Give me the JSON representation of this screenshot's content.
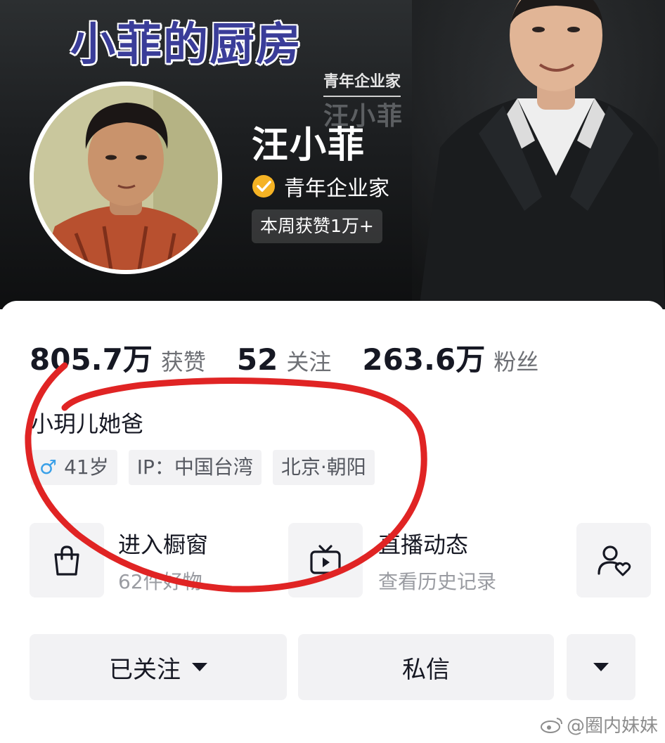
{
  "banner": {
    "title": "小菲的厨房",
    "tagline": "青年企业家",
    "name_ghost": "汪小菲"
  },
  "profile": {
    "name": "汪小菲",
    "verified_text": "青年企业家",
    "weekly_badge": "本周获赞1万+",
    "bio": "小玥儿她爸"
  },
  "stats": [
    {
      "value": "805.7万",
      "label": "获赞"
    },
    {
      "value": "52",
      "label": "关注"
    },
    {
      "value": "263.6万",
      "label": "粉丝"
    }
  ],
  "tags": {
    "gender_icon": "♂",
    "age": "41岁",
    "ip": "IP：中国台湾",
    "location": "北京·朝阳"
  },
  "tiles": {
    "shop_title": "进入橱窗",
    "shop_sub": "62件好物",
    "live_title": "直播动态",
    "live_sub": "查看历史记录"
  },
  "actions": {
    "follow": "已关注",
    "message": "私信"
  },
  "watermark": "@圈内妹妹",
  "colors": {
    "annotation": "#e02424",
    "verified": "#f5b324",
    "gender": "#3aa0e8",
    "title_purple": "#3a3d99"
  }
}
